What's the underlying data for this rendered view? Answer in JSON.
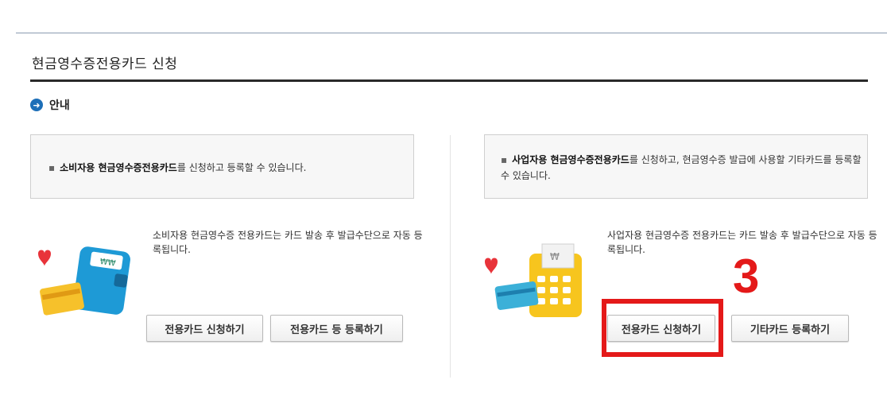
{
  "page": {
    "title": "현금영수증전용카드 신청"
  },
  "section": {
    "label": "안내"
  },
  "consumer": {
    "notice_bold": "소비자용 현금영수증전용카드",
    "notice_rest": "를 신청하고 등록할 수 있습니다.",
    "description": "소비자용 현금영수증 전용카드는 카드 발송 후 발급수단으로 자동 등록됩니다.",
    "apply_button": "전용카드 신청하기",
    "register_button": "전용카드 등 등록하기"
  },
  "business": {
    "notice_bold": "사업자용 현금영수증전용카드",
    "notice_rest": "를 신청하고, 현금영수증 발급에 사용할 기타카드를 등록할 수 있습니다.",
    "description": "사업자용 현금영수증 전용카드는 카드 발송 후 발급수단으로 자동 등록됩니다.",
    "apply_button": "전용카드 신청하기",
    "register_button": "기타카드 등록하기"
  },
  "annotation": {
    "step_number": "3",
    "color": "#e41919"
  },
  "colors": {
    "accent": "#1d6fb8",
    "rule": "#2a2a2a"
  },
  "icons": [
    "arrow-circle-icon",
    "wallet-cards-illustration",
    "calculator-cards-illustration"
  ]
}
